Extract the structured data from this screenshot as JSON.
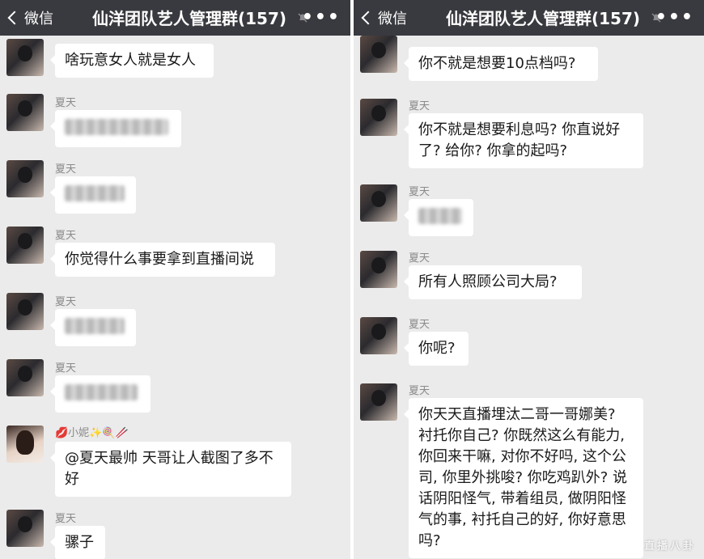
{
  "left": {
    "header": {
      "back_label": "微信",
      "title": "仙洋团队艺人管理群(157)",
      "more": "•••"
    },
    "messages": [
      {
        "name": "",
        "text": "啥玩意女人就是女人"
      },
      {
        "name": "夏天",
        "text": ""
      },
      {
        "name": "夏天",
        "text": ""
      },
      {
        "name": "夏天",
        "text": "你觉得什么事要拿到直播间说"
      },
      {
        "name": "夏天",
        "text": ""
      },
      {
        "name": "夏天",
        "text": ""
      },
      {
        "name": "💋小妮✨🍭🥢",
        "text": "@夏天最帅 天哥让人截图了多不好"
      },
      {
        "name": "夏天",
        "text": "骡子"
      }
    ]
  },
  "right": {
    "header": {
      "back_label": "微信",
      "title": "仙洋团队艺人管理群(157)",
      "more": "•••"
    },
    "messages": [
      {
        "name": "",
        "text": "你不就是想要10点档吗?"
      },
      {
        "name": "夏天",
        "text": "你不就是想要利息吗? 你直说好了? 给你? 你拿的起吗?"
      },
      {
        "name": "夏天",
        "text": ""
      },
      {
        "name": "夏天",
        "text": "所有人照顾公司大局?"
      },
      {
        "name": "夏天",
        "text": "你呢?"
      },
      {
        "name": "夏天",
        "text": "你天天直播埋汰二哥一哥娜美? 衬托你自己? 你既然这么有能力, 你回来干嘛, 对你不好吗, 这个公司, 你里外挑唆? 你吃鸡趴外? 说话阴阳怪气, 带着组员, 做阴阳怪气的事, 衬托自己的好, 你好意思吗?"
      }
    ],
    "watermark": "直播八卦"
  }
}
